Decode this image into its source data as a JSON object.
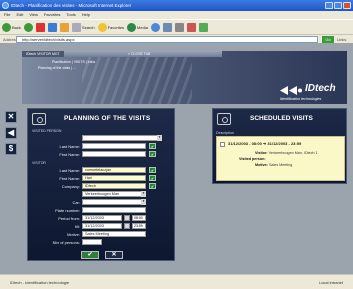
{
  "window": {
    "title": "IDtech - Planification des visites - Microsoft Internet Explorer"
  },
  "menu": [
    "File",
    "Edit",
    "View",
    "Favorites",
    "Tools",
    "Help"
  ],
  "toolbar": {
    "back_label": "Back",
    "search_label": "Search",
    "favorites_label": "Favorites",
    "media_label": "Media"
  },
  "address": {
    "label": "Address",
    "url": "http://server/idtech/visits.aspx",
    "go_label": "Go",
    "links_label": "Links"
  },
  "app": {
    "tab_title": "IDtech VISITOR MGT",
    "tab_close": "× CLOSE TAB",
    "nav_line_1": "Planification   |   VISITS   |   Infos",
    "nav_line_2": "Planning of the visits  |  ...",
    "logo_text": "IDtech",
    "logo_sub": "Identification technologies"
  },
  "side_buttons": [
    {
      "name": "close",
      "glyph": "✕"
    },
    {
      "name": "car",
      "glyph": "◀"
    },
    {
      "name": "dollar",
      "glyph": "$"
    }
  ],
  "planning": {
    "title": "PLANNING OF THE VISITS",
    "visited_person_label": "VISITED PERSON",
    "visitor_label": "VISITOR",
    "fields": {
      "vp_select": "",
      "vp_last_name_label": "Last Name:",
      "vp_last_name": "",
      "vp_first_name_label": "First Name:",
      "vp_first_name": "",
      "v_last_name_label": "Last Name:",
      "v_last_name": "comsetelaczjan",
      "v_first_name_label": "First Name:",
      "v_first_name": "Hari",
      "v_company_label": "Company:",
      "v_company": "IDtech",
      "v_company_select": "Verkeerboogen Man",
      "v_car_label": "Car:",
      "v_car": "",
      "v_plate_label": "Plate number:",
      "v_plate": "",
      "from_label": "Period from:",
      "from_date": "31/12/2003",
      "from_time": "08:00",
      "till_label": "till:",
      "till_date": "31/12/2003",
      "till_time": "23:59",
      "motive_label": "Motive:",
      "motive": "Sales Meeting",
      "nb_persons_label": "Nbr of persons:",
      "nb_persons": ""
    },
    "ok_glyph": "✔",
    "cancel_glyph": "✕"
  },
  "scheduled": {
    "title": "SCHEDULED VISITS",
    "desc_label": "Description",
    "item": {
      "time": "31/12/2003 - 08:00  ➔  31/12/2003 - 23:59",
      "visitor_label": "Visitor:",
      "visitor": "Verkeerboogen Man, IDtech 1",
      "visited_label": "Visited person:",
      "visited": "",
      "motive_label": "Motive:",
      "motive": "Sales Meeting"
    }
  },
  "status": {
    "text": "IDtech - Identification technologie",
    "zone": "Local intranet"
  },
  "colors": {
    "panel_bg": "#0d1730",
    "accent_green": "#2e7d3a",
    "visit_bg": "#fbf8c8"
  }
}
